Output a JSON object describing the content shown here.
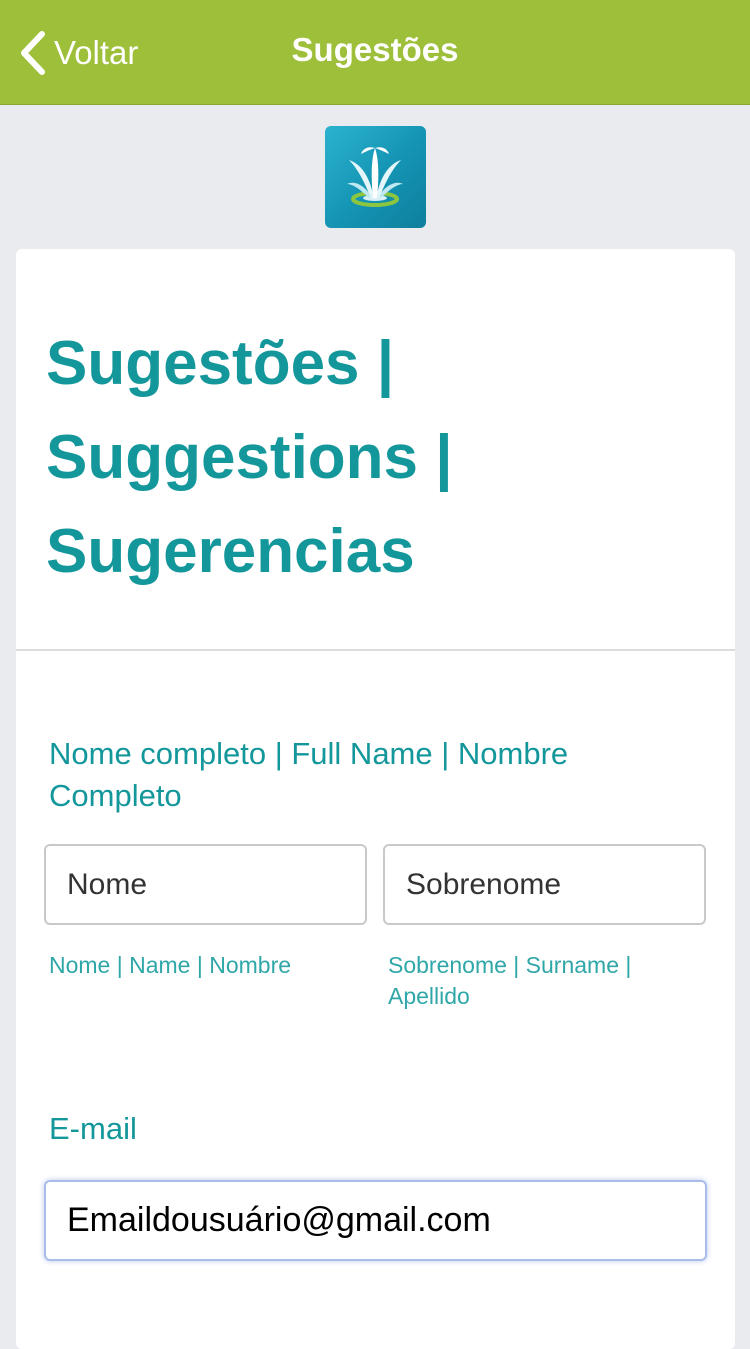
{
  "navbar": {
    "back_label": "Voltar",
    "title": "Sugestões",
    "color": "#9dbf3a"
  },
  "logo": {
    "icon": "fountain-logo-icon"
  },
  "card": {
    "title": "Sugestões | Suggestions | Sugerencias",
    "full_name_label": "Nome completo | Full Name | Nombre Completo",
    "first_name": {
      "placeholder": "Nome",
      "sublabel": "Nome | Name | Nombre"
    },
    "last_name": {
      "placeholder": "Sobrenome",
      "sublabel": "Sobrenome | Surname | Apellido"
    },
    "email": {
      "label": "E-mail",
      "value": "Emaildousuário@gmail.com"
    },
    "accent_color": "#14979b"
  }
}
